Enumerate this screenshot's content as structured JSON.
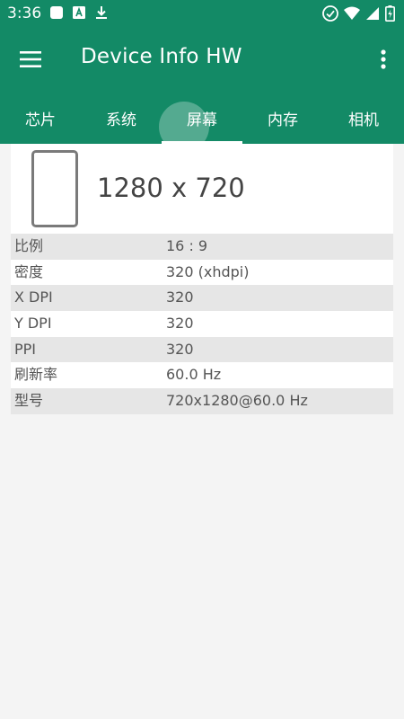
{
  "status_bar": {
    "time": "3:36",
    "left_icons": [
      "app-icon",
      "text-a-icon",
      "download-icon"
    ],
    "right_icons": [
      "dnd-icon",
      "wifi-icon",
      "signal-icon",
      "battery-charging-icon"
    ]
  },
  "app_bar": {
    "title": "Device Info HW",
    "menu_icon": "hamburger-menu-icon",
    "overflow_icon": "more-vert-icon",
    "color": "#138a66"
  },
  "tabs": [
    {
      "label": "芯片",
      "active": false
    },
    {
      "label": "系统",
      "active": false
    },
    {
      "label": "屏幕",
      "active": true
    },
    {
      "label": "内存",
      "active": false
    },
    {
      "label": "相机",
      "active": false
    }
  ],
  "screen": {
    "icon": "phone-outline-icon",
    "resolution": "1280 x 720",
    "rows": [
      {
        "key": "比例",
        "value": "16 : 9"
      },
      {
        "key": "密度",
        "value": "320 (xhdpi)"
      },
      {
        "key": "X DPI",
        "value": "320"
      },
      {
        "key": "Y DPI",
        "value": "320"
      },
      {
        "key": "PPI",
        "value": "320"
      },
      {
        "key": "刷新率",
        "value": "60.0 Hz"
      },
      {
        "key": "型号",
        "value": "720x1280@60.0 Hz"
      }
    ]
  }
}
